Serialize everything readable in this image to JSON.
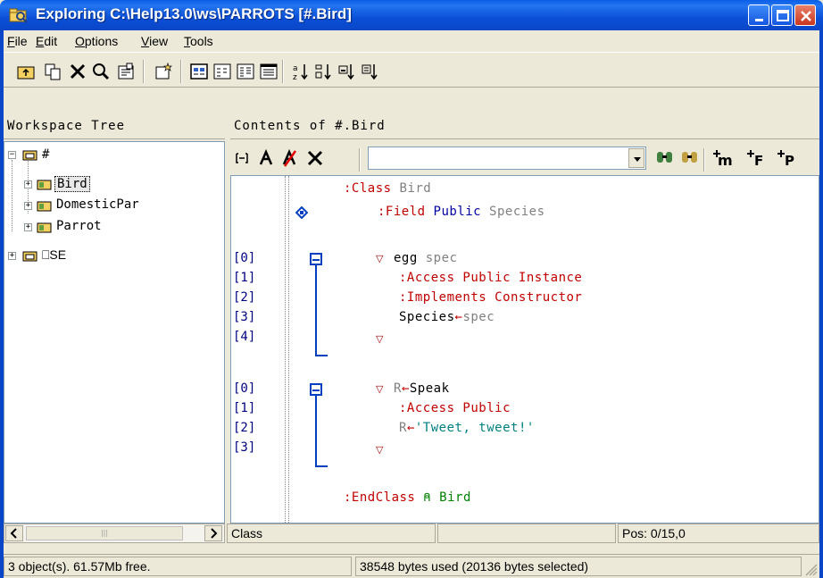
{
  "window": {
    "title": "Exploring C:\\Help13.0\\ws\\PARROTS [#.Bird]"
  },
  "menu": [
    {
      "ul": "F",
      "rest": "ile"
    },
    {
      "ul": "E",
      "rest": "dit"
    },
    {
      "ul": "O",
      "rest": "ptions"
    },
    {
      "ul": "V",
      "rest": "iew"
    },
    {
      "ul": "T",
      "rest": "ools"
    }
  ],
  "toolbar_icons": [
    "folder-up-icon",
    "copy-icon",
    "delete-icon",
    "find-icon",
    "properties-icon",
    "new-icon",
    "large-icons-icon",
    "small-icons-icon",
    "list-icon",
    "details-icon",
    "sort-name-icon",
    "sort-type-icon",
    "sort-size-icon",
    "sort-date-icon"
  ],
  "tree": {
    "header": "Workspace Tree",
    "root": "#",
    "children": [
      "Bird",
      "DomesticPar",
      "Parrot"
    ],
    "second_root": "⎕SE"
  },
  "contents": {
    "header": "Contents of #.Bird",
    "toolbar": {
      "combo_value": ""
    }
  },
  "code": {
    "class_line": {
      "kw": ":Class",
      "name": "Bird"
    },
    "field_line": {
      "kw": ":Field",
      "access": "Public",
      "name": "Species"
    },
    "block1": {
      "line_numbers": [
        "[0]",
        "[1]",
        "[2]",
        "[3]",
        "[4]"
      ],
      "header": {
        "fn": "egg",
        "arg": "spec"
      },
      "access": ":Access Public Instance",
      "implements": ":Implements Constructor",
      "assign": {
        "lhs": "Species",
        "arrow": "←",
        "rhs": "spec"
      }
    },
    "block2": {
      "line_numbers": [
        "[0]",
        "[1]",
        "[2]",
        "[3]"
      ],
      "header": {
        "res": "R",
        "arrow": "←",
        "fn": "Speak"
      },
      "access": ":Access Public",
      "assign": {
        "lhs": "R",
        "arrow": "←",
        "str": "'Tweet, tweet!'"
      }
    },
    "end_line": {
      "kw": ":EndClass",
      "comment": "⍝ Bird"
    }
  },
  "status": {
    "mid_type": "Class",
    "mid_empty": "",
    "position": "Pos: 0/15,0",
    "left": "3 object(s). 61.57Mb free.",
    "right": "38548 bytes used (20136 bytes selected)"
  },
  "colors": {
    "keyword": "#c00000",
    "identifier": "#0000a0",
    "string": "#008080",
    "comment": "#008000",
    "fold": "#0040c0"
  }
}
